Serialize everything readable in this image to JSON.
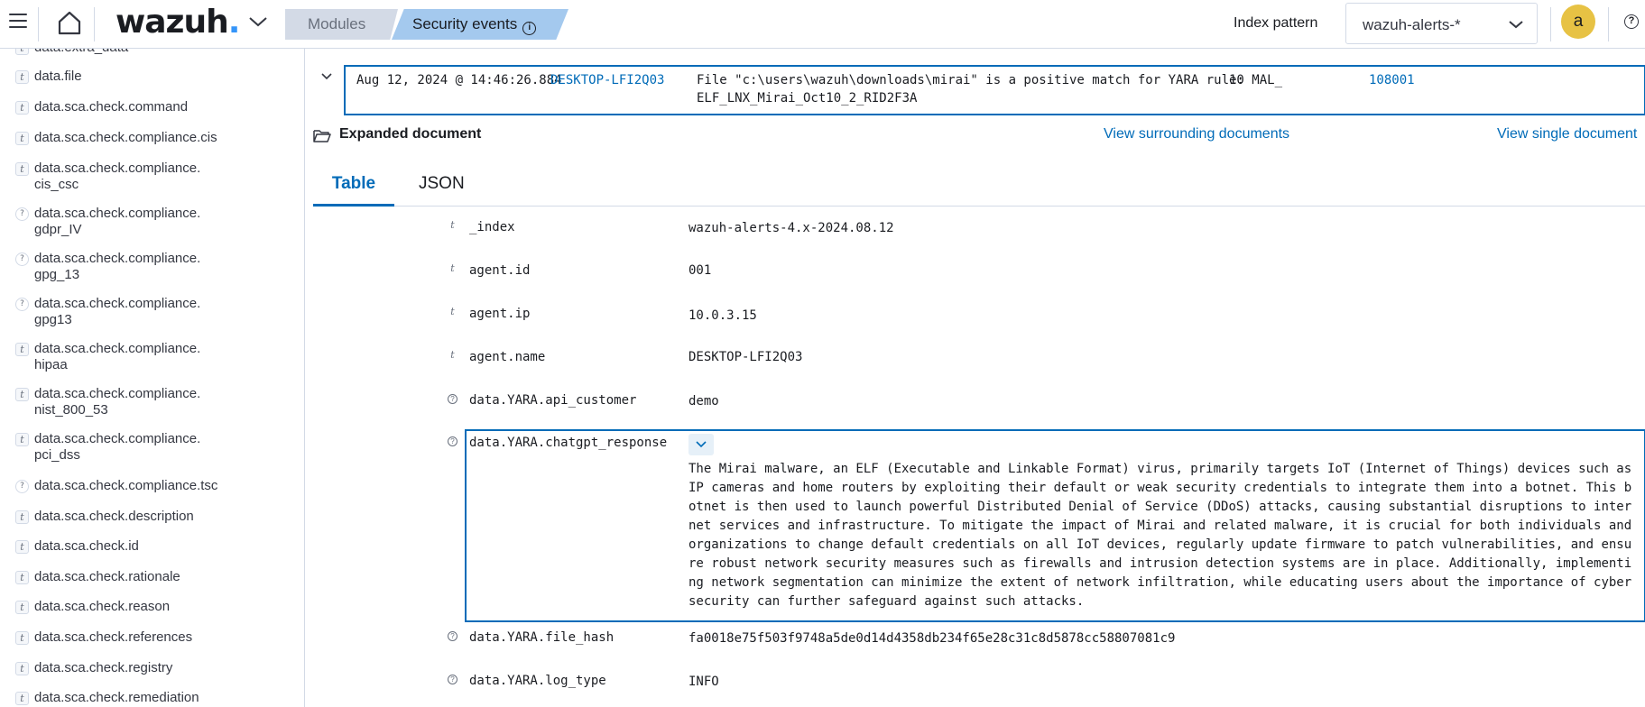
{
  "header": {
    "logo_text": "wazuh",
    "logo_dot": ".",
    "breadcrumb": [
      {
        "label": "Modules"
      },
      {
        "label": "Security events"
      }
    ],
    "index_pattern_label": "Index pattern",
    "index_pattern_value": "wazuh-alerts-*",
    "avatar_initial": "a",
    "help_glyph": "?"
  },
  "sidebar": {
    "fields": [
      {
        "type": "t",
        "name": "data.extra_data"
      },
      {
        "type": "t",
        "name": "data.file"
      },
      {
        "type": "t",
        "name": "data.sca.check.command"
      },
      {
        "type": "t",
        "name": "data.sca.check.compliance.cis"
      },
      {
        "type": "t",
        "name": "data.sca.check.compliance.",
        "name2": "cis_csc"
      },
      {
        "type": "?",
        "name": "data.sca.check.compliance.",
        "name2": "gdpr_IV"
      },
      {
        "type": "?",
        "name": "data.sca.check.compliance.",
        "name2": "gpg_13"
      },
      {
        "type": "?",
        "name": "data.sca.check.compliance.",
        "name2": "gpg13"
      },
      {
        "type": "t",
        "name": "data.sca.check.compliance.",
        "name2": "hipaa"
      },
      {
        "type": "t",
        "name": "data.sca.check.compliance.",
        "name2": "nist_800_53"
      },
      {
        "type": "t",
        "name": "data.sca.check.compliance.",
        "name2": "pci_dss"
      },
      {
        "type": "?",
        "name": "data.sca.check.compliance.tsc"
      },
      {
        "type": "t",
        "name": "data.sca.check.description"
      },
      {
        "type": "t",
        "name": "data.sca.check.id"
      },
      {
        "type": "t",
        "name": "data.sca.check.rationale"
      },
      {
        "type": "t",
        "name": "data.sca.check.reason"
      },
      {
        "type": "t",
        "name": "data.sca.check.references"
      },
      {
        "type": "t",
        "name": "data.sca.check.registry"
      },
      {
        "type": "t",
        "name": "data.sca.check.remediation"
      }
    ]
  },
  "doc_row": {
    "time": "Aug 12, 2024 @ 14:46:26.884",
    "agent": "DESKTOP-LFI2Q03",
    "description_line1": "File \"c:\\users\\wazuh\\downloads\\mirai\" is a positive match for YARA rule: MAL_",
    "description_line2": "ELF_LNX_Mirai_Oct10_2_RID2F3A",
    "level": "10",
    "rule_id": "108001"
  },
  "expanded": {
    "title": "Expanded document",
    "view_surrounding": "View surrounding documents",
    "view_single": "View single document",
    "tabs": [
      {
        "label": "Table",
        "active": true
      },
      {
        "label": "JSON",
        "active": false
      }
    ],
    "fields": {
      "index": {
        "name": "_index",
        "value": "wazuh-alerts-4.x-2024.08.12"
      },
      "agent_id": {
        "name": "agent.id",
        "value": "001"
      },
      "agent_ip": {
        "name": "agent.ip",
        "value": "10.0.3.15"
      },
      "agent_name": {
        "name": "agent.name",
        "value": "DESKTOP-LFI2Q03"
      },
      "api_customer": {
        "name": "data.YARA.api_customer",
        "value": "demo"
      },
      "chatgpt": {
        "name": "data.YARA.chatgpt_response",
        "value": "The Mirai malware, an ELF (Executable and Linkable Format) virus, primarily targets IoT (Internet of Things) devices such as IP cameras and home routers by exploiting their default or weak security credentials to integrate them into a botnet. This botnet is then used to launch powerful Distributed Denial of Service (DDoS) attacks, causing substantial disruptions to internet services and infrastructure. To mitigate the impact of Mirai and related malware, it is crucial for both individuals and organizations to change default credentials on all IoT devices, regularly update firmware to patch vulnerabilities, and ensure robust network security measures such as firewalls and intrusion detection systems are in place. Additionally, implementing network segmentation can minimize the extent of network infiltration, while educating users about the importance of cybersecurity can further safeguard against such attacks."
      },
      "file_hash": {
        "name": "data.YARA.file_hash",
        "value": "fa0018e75f503f9748a5de0d14d4358db234f65e28c31c8d5878cc58807081c9"
      },
      "log_type": {
        "name": "data.YARA.log_type",
        "value": "INFO"
      }
    }
  },
  "colors": {
    "accent": "#006bb8",
    "logo_dot": "#3595f9",
    "breadcrumb_active": "#a4c9ee",
    "avatar": "#e7c244"
  }
}
